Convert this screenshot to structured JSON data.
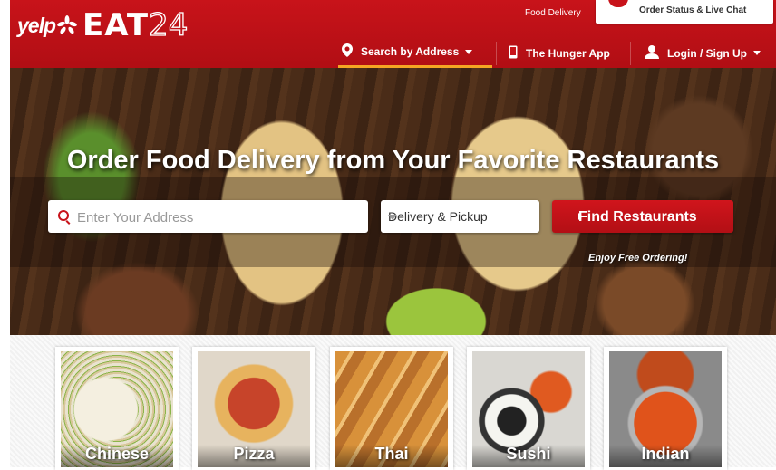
{
  "header": {
    "logo": {
      "yelp": "yelp",
      "eat": "EAT",
      "num": "24"
    },
    "food_delivery_label": "Food Delivery",
    "order_status_label": "Order Status & Live Chat",
    "nav": {
      "search_by_address": "Search by Address",
      "hunger_app": "The Hunger App",
      "login": "Login / Sign Up"
    },
    "brand_color": "#c8131a",
    "active_underline_color": "#f5a623"
  },
  "hero": {
    "title": "Order Food Delivery from Your Favorite Restaurants",
    "address_placeholder": "Enter Your Address",
    "address_value": "",
    "service_select": "Delivery & Pickup",
    "find_button": "Find Restaurants",
    "free_ordering": "Enjoy Free Ordering!"
  },
  "categories": [
    {
      "label": "Chinese"
    },
    {
      "label": "Pizza"
    },
    {
      "label": "Thai"
    },
    {
      "label": "Sushi"
    },
    {
      "label": "Indian"
    }
  ]
}
